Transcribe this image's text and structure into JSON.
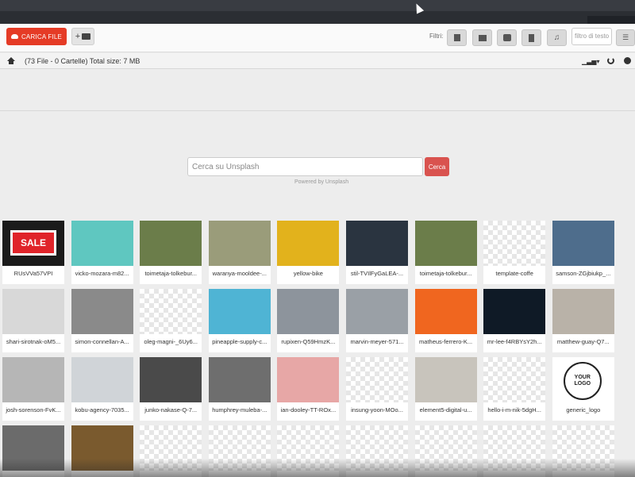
{
  "toolbar": {
    "upload_label": "CARICA FILE",
    "new_folder_label": "+",
    "filters_label": "Filtri:",
    "text_filter_placeholder": "filtro di testo"
  },
  "filter_icons": [
    "file-icon",
    "image-icon",
    "archive-icon",
    "video-icon",
    "music-icon"
  ],
  "breadcrumb": {
    "summary": "(73 File - 0 Cartelle) Total size: 7 MB"
  },
  "unsplash": {
    "search_placeholder": "Cerca su Unsplash",
    "search_button": "Cerca",
    "powered_by": "Powered by Unsplash"
  },
  "sale_sign_text": "SALE",
  "logo_text": [
    "YOUR",
    "LOGO"
  ],
  "files": [
    {
      "label": "RUsVVa57VPI",
      "color": "#1b1b1b"
    },
    {
      "label": "vicko-mozara-m82...",
      "color": "#5fc7c0"
    },
    {
      "label": "toimetaja-tolkebur...",
      "color": "#6b7d4a"
    },
    {
      "label": "waranya-mooldee-...",
      "color": "#9a9c7a"
    },
    {
      "label": "yellow-bike",
      "color": "#e2b21c"
    },
    {
      "label": "stil-TVIlFyGaLEA-...",
      "color": "#2a3440"
    },
    {
      "label": "toimetaja-tolkebur...",
      "color": "#6b7d4a"
    },
    {
      "label": "template-coffe",
      "color": "checker"
    },
    {
      "label": "samson-ZGjbiukp_...",
      "color": "#4e6d8c"
    },
    {
      "label": "shari-sirotnak-oM5...",
      "color": "#d8d8d8"
    },
    {
      "label": "simon-connellan-A...",
      "color": "#8a8a8a"
    },
    {
      "label": "oleg-magni-_6Uy6...",
      "color": "checker"
    },
    {
      "label": "pineapple-supply-c...",
      "color": "#4fb4d4"
    },
    {
      "label": "rupixen-Q59HmzK...",
      "color": "#8d949c"
    },
    {
      "label": "marvin-meyer-571...",
      "color": "#9aa0a6"
    },
    {
      "label": "matheus-ferrero-K...",
      "color": "#f0661f"
    },
    {
      "label": "mr-lee-f4RBYsY2h...",
      "color": "#0f1a26"
    },
    {
      "label": "matthew-guay-Q7...",
      "color": "#b9b2a8"
    },
    {
      "label": "josh-sorenson-FvK...",
      "color": "#b6b6b6"
    },
    {
      "label": "kobu-agency-7035...",
      "color": "#d0d4d8"
    },
    {
      "label": "junko-nakase-Q-7...",
      "color": "#4a4a4a"
    },
    {
      "label": "humphrey-muleba-...",
      "color": "#6e6e6e"
    },
    {
      "label": "ian-dooley-TT-ROx...",
      "color": "#e7a7a6"
    },
    {
      "label": "insung-yoon-MOo...",
      "color": "checker"
    },
    {
      "label": "element5-digital-u...",
      "color": "#c8c4bc"
    },
    {
      "label": "hello-i-m-nik-5dgH...",
      "color": "checker"
    },
    {
      "label": "generic_logo",
      "color": "#ffffff"
    },
    {
      "label": "",
      "color": "#6b6b6b"
    },
    {
      "label": "",
      "color": "#7a5a2e"
    },
    {
      "label": "",
      "color": "checker"
    },
    {
      "label": "",
      "color": "checker"
    },
    {
      "label": "",
      "color": "checker"
    },
    {
      "label": "",
      "color": "checker"
    },
    {
      "label": "",
      "color": "checker"
    },
    {
      "label": "",
      "color": "checker"
    },
    {
      "label": "",
      "color": "checker"
    }
  ],
  "colors": {
    "accent": "#e53b26",
    "search_button": "#d9534f"
  }
}
